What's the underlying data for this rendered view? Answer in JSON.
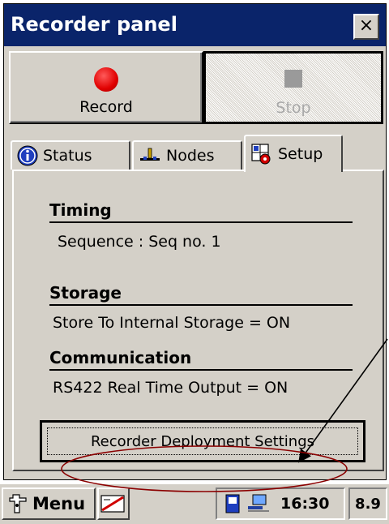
{
  "window": {
    "title": "Recorder panel",
    "close_label": "×"
  },
  "controls": {
    "record_label": "Record",
    "stop_label": "Stop"
  },
  "tabs": [
    {
      "label": "Status",
      "icon": "info-icon",
      "active": false
    },
    {
      "label": "Nodes",
      "icon": "nodes-icon",
      "active": false
    },
    {
      "label": "Setup",
      "icon": "setup-icon",
      "active": true
    }
  ],
  "setup": {
    "timing": {
      "heading": "Timing",
      "value": "Sequence : Seq no. 1"
    },
    "storage": {
      "heading": "Storage",
      "value": "Store To Internal Storage = ON"
    },
    "communication": {
      "heading": "Communication",
      "value": "RS422 Real Time Output = ON"
    },
    "deploy_button_label": "Recorder Deployment Settings"
  },
  "taskbar": {
    "start_label": "Menu",
    "clock": "16:30",
    "version": "8.9"
  },
  "colors": {
    "titlebar": "#0a246a",
    "face": "#d4d0c8",
    "record": "#e00000",
    "annotation_ellipse": "#8b0000"
  }
}
